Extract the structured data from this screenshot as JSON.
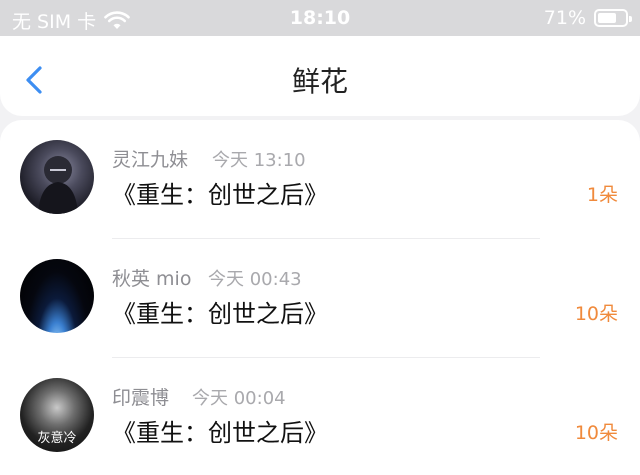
{
  "status_bar": {
    "carrier": "无 SIM 卡",
    "time": "18:10",
    "battery_text": "71%",
    "battery_level": 0.71
  },
  "nav": {
    "title": "鲜花"
  },
  "records": [
    {
      "name": "灵江九妹",
      "time": "今天 13:10",
      "book": "《重生：创世之后》",
      "amount": "1朵",
      "avatar_text": ""
    },
    {
      "name": "秋英 mio",
      "time": "今天 00:43",
      "book": "《重生：创世之后》",
      "amount": "10朵",
      "avatar_text": ""
    },
    {
      "name": "印震博",
      "time": "今天 00:04",
      "book": "《重生：创世之后》",
      "amount": "10朵",
      "avatar_text": "灰意冷"
    }
  ],
  "colors": {
    "accent_blue": "#3d8ef2",
    "amount_orange": "#f08a3c"
  }
}
